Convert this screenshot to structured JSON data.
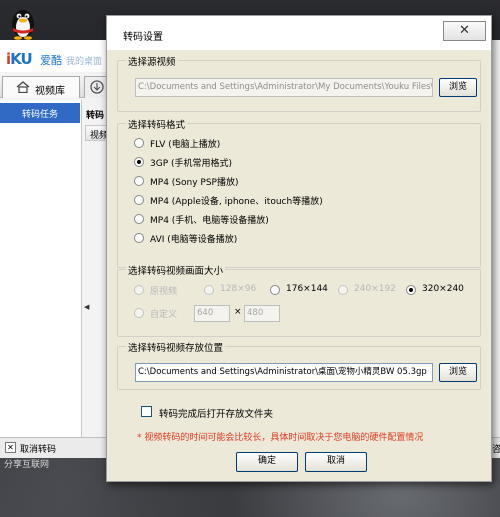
{
  "background_app": {
    "logo": "iKU",
    "name": "爱酷",
    "subtitle": "我的桌面",
    "tab_library": "视频库",
    "sidebar_task": "转码任务",
    "main_title": "转码",
    "main_column": "视频",
    "statusbar_cancel": "取消转码",
    "statusbar_right": "咨",
    "bottom_caption": "分享互联网"
  },
  "dialog": {
    "title": "转码设置",
    "close_glyph": "✕",
    "source": {
      "group_label": "选择源视频",
      "path": "C:\\Documents and Settings\\Administrator\\My Documents\\Youku Files\\downlo",
      "browse_label": "浏览"
    },
    "format": {
      "group_label": "选择转码格式",
      "selected": "3gp",
      "options": [
        {
          "id": "flv",
          "label": "FLV (电脑上播放)",
          "checked": false
        },
        {
          "id": "3gp",
          "label": "3GP (手机常用格式)",
          "checked": true
        },
        {
          "id": "psp",
          "label": "MP4 (Sony PSP播放)",
          "checked": false
        },
        {
          "id": "apple",
          "label": "MP4 (Apple设备, iphone、itouch等播放)",
          "checked": false
        },
        {
          "id": "mobile",
          "label": "MP4 (手机、电脑等设备播放)",
          "checked": false
        },
        {
          "id": "avi",
          "label": "AVI (电脑等设备播放)",
          "checked": false
        }
      ]
    },
    "size": {
      "group_label": "选择转码视频画面大小",
      "options": [
        {
          "id": "original",
          "label": "原视频",
          "enabled": false,
          "checked": false
        },
        {
          "id": "128x96",
          "label": "128×96",
          "enabled": false,
          "checked": false
        },
        {
          "id": "176x144",
          "label": "176×144",
          "enabled": true,
          "checked": false
        },
        {
          "id": "240x192",
          "label": "240×192",
          "enabled": false,
          "checked": false
        },
        {
          "id": "320x240",
          "label": "320×240",
          "enabled": true,
          "checked": true
        }
      ],
      "custom_label": "自定义",
      "width_value": "640",
      "times": "×",
      "height_value": "480"
    },
    "output": {
      "group_label": "选择转码视频存放位置",
      "path": "C:\\Documents and Settings\\Administrator\\桌面\\宠物小精灵BW 05.3gp",
      "browse_label": "浏览"
    },
    "open_folder_label": "转码完成后打开存放文件夹",
    "note": "* 视频转码的时间可能会比较长，具体时间取决于您电脑的硬件配置情况",
    "ok_label": "确定",
    "cancel_label": "取消"
  }
}
